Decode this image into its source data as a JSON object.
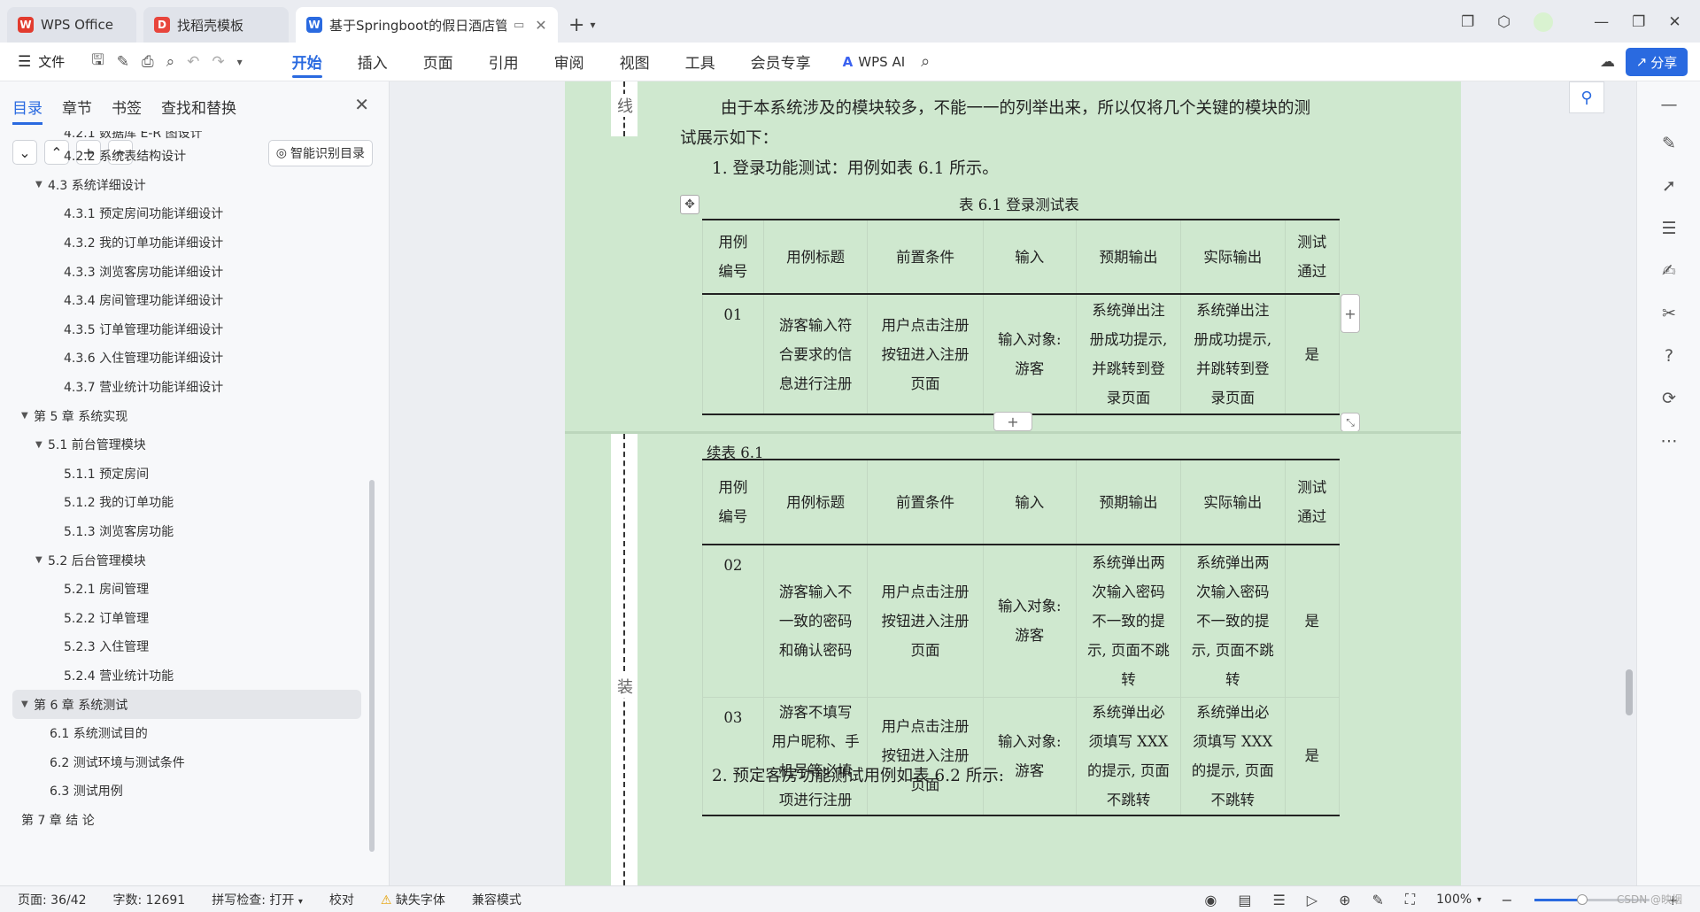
{
  "tabs": [
    {
      "label": "WPS Office",
      "icon": "wps-logo-icon",
      "color": "#e23b2e"
    },
    {
      "label": "找稻壳模板",
      "icon": "docer-logo-icon",
      "color": "#e8453c"
    },
    {
      "label": "基于Springboot的假日酒店管",
      "icon": "word-doc-icon",
      "color": "#2a6ae0"
    }
  ],
  "menubar": {
    "file_label": "文件",
    "menus": [
      "开始",
      "插入",
      "页面",
      "引用",
      "审阅",
      "视图",
      "工具",
      "会员专享"
    ],
    "active_menu": "开始",
    "wps_ai_label": "WPS AI",
    "share_label": "分享"
  },
  "leftpanel": {
    "tabs": [
      "目录",
      "章节",
      "书签",
      "查找和替换"
    ],
    "smart_toc_label": "智能识别目录",
    "toc": [
      {
        "text": "4.2.1 数据库 E-R 图设计",
        "level": 3
      },
      {
        "text": "4.2.2  系统表结构设计",
        "level": 3
      },
      {
        "text": "4.3   系统详细设计",
        "level": 2,
        "expanded": true
      },
      {
        "text": "4.3.1   预定房间功能详细设计",
        "level": 3
      },
      {
        "text": "4.3.2   我的订单功能详细设计",
        "level": 3
      },
      {
        "text": "4.3.3   浏览客房功能详细设计",
        "level": 3
      },
      {
        "text": "4.3.4   房间管理功能详细设计",
        "level": 3
      },
      {
        "text": "4.3.5   订单管理功能详细设计",
        "level": 3
      },
      {
        "text": "4.3.6   入住管理功能详细设计",
        "level": 3
      },
      {
        "text": "4.3.7   营业统计功能详细设计",
        "level": 3
      },
      {
        "text": "第 5 章   系统实现",
        "level": 1,
        "expanded": true
      },
      {
        "text": "5.1    前台管理模块",
        "level": 2,
        "expanded": true
      },
      {
        "text": "5.1.1    预定房间",
        "level": 3
      },
      {
        "text": "5.1.2    我的订单功能",
        "level": 3
      },
      {
        "text": "5.1.3    浏览客房功能",
        "level": 3
      },
      {
        "text": "5.2    后台管理模块",
        "level": 2,
        "expanded": true
      },
      {
        "text": "5.2.1  房间管理",
        "level": 3
      },
      {
        "text": "5.2.2  订单管理",
        "level": 3
      },
      {
        "text": "5.2.3  入住管理",
        "level": 3
      },
      {
        "text": "5.2.4  营业统计功能",
        "level": 3
      },
      {
        "text": "第 6 章   系统测试",
        "level": 1,
        "expanded": true,
        "selected": true
      },
      {
        "text": "6.1 系统测试目的",
        "level": 2
      },
      {
        "text": "6.2 测试环境与测试条件",
        "level": 2
      },
      {
        "text": "6.3 测试用例",
        "level": 2
      },
      {
        "text": "第 7 章   结   论",
        "level": 1
      }
    ]
  },
  "document": {
    "gutter_char_top": "线",
    "gutter_char_mid": "装",
    "para1_line1": "由于本系统涉及的模块较多，不能一一的列举出来，所以仅将几个关键的模块的测",
    "para1_line2": "试展示如下：",
    "item1": "1.   登录功能测试：用例如表 6.1 所示。",
    "table1_caption": "表 6.1 登录测试表",
    "table2_caption": "续表 6.1",
    "headers": [
      [
        "用例",
        "编号"
      ],
      [
        "用例标题"
      ],
      [
        "前置条件"
      ],
      [
        "输入"
      ],
      [
        "预期输出"
      ],
      [
        "实际输出"
      ],
      [
        "测试",
        "通过"
      ]
    ],
    "rows_t1": [
      {
        "id": "01",
        "title": [
          "游客输入符",
          "合要求的信",
          "息进行注册"
        ],
        "pre": [
          "用户点击注册",
          "按钮进入注册",
          "页面"
        ],
        "input": [
          "输入对象:",
          "游客"
        ],
        "expected": [
          "系统弹出注",
          "册成功提示,",
          "并跳转到登",
          "录页面"
        ],
        "actual": [
          "系统弹出注",
          "册成功提示,",
          "并跳转到登",
          "录页面"
        ],
        "pass": "是"
      }
    ],
    "rows_t2": [
      {
        "id": "02",
        "title": [
          "游客输入不",
          "一致的密码",
          "和确认密码"
        ],
        "pre": [
          "用户点击注册",
          "按钮进入注册",
          "页面"
        ],
        "input": [
          "输入对象:",
          "游客"
        ],
        "expected": [
          "系统弹出两",
          "次输入密码",
          "不一致的提",
          "示, 页面不跳",
          "转"
        ],
        "actual": [
          "系统弹出两",
          "次输入密码",
          "不一致的提",
          "示, 页面不跳",
          "转"
        ],
        "pass": "是"
      },
      {
        "id": "03",
        "title": [
          "游客不填写",
          "用户昵称、手",
          "机号等必填",
          "项进行注册"
        ],
        "pre": [
          "用户点击注册",
          "按钮进入注册",
          "页面"
        ],
        "input": [
          "输入对象:",
          "游客"
        ],
        "expected": [
          "系统弹出必",
          "须填写 XXX",
          "的提示, 页面",
          "不跳转"
        ],
        "actual": [
          "系统弹出必",
          "须填写 XXX",
          "的提示, 页面",
          "不跳转"
        ],
        "pass": "是"
      }
    ],
    "item2": "2.   预定客房功能测试用例如表 6.2 所示:"
  },
  "statusbar": {
    "page": "页面: 36/42",
    "words": "字数: 12691",
    "spell": "拼写检查: 打开",
    "proof": "校对",
    "missing_font": "缺失字体",
    "compat": "兼容模式",
    "zoom": "100%",
    "zoom_fraction": 0.42,
    "watermark": "CSDN @映烟"
  },
  "colors": {
    "accent": "#2a6ae0",
    "page_bg": "#cfe8cf"
  }
}
